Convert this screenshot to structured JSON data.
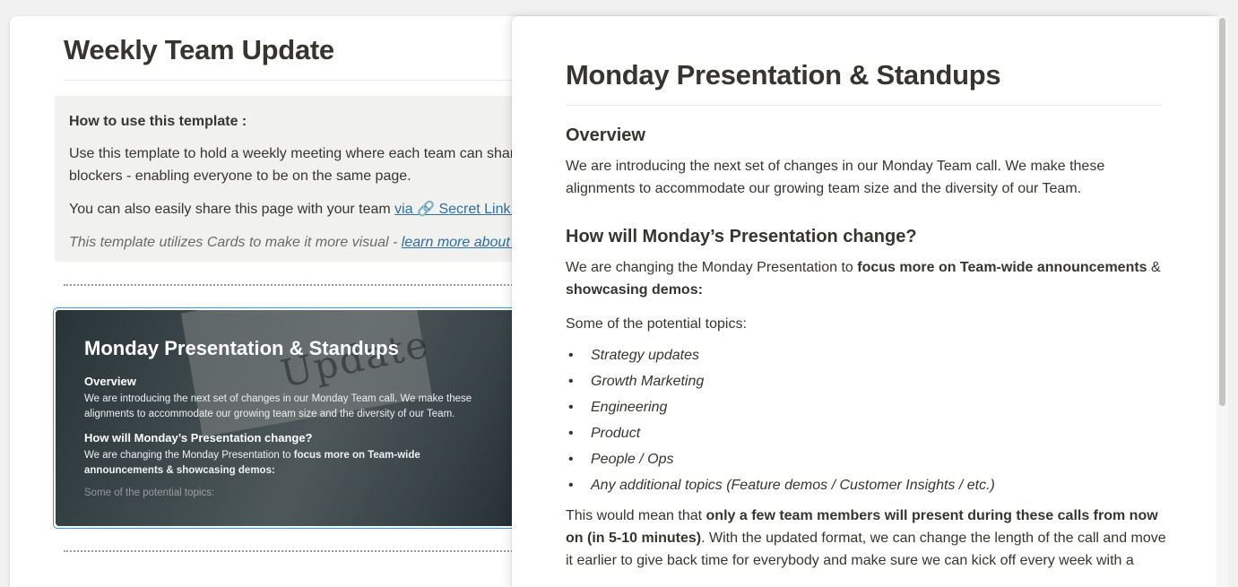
{
  "doc": {
    "title": "Weekly Team Update",
    "callout": {
      "heading": "How to use this template :",
      "line1": "Use this template to hold a weekly meeting where each team can share",
      "line2": "blockers - enabling everyone to be on the same page.",
      "share_text": "You can also easily share this page with your team ",
      "share_link": " via 🔗 Secret Link.",
      "cards_text": "This template utilizes Cards to make it more visual - ",
      "cards_link": "learn more about c"
    },
    "card": {
      "image_word": "Update",
      "title": "Monday Presentation & Standups",
      "overview_heading": "Overview",
      "overview_text": "We are introducing the next set of changes in our Monday Team call. We make these alignments to accommodate our growing team size and the diversity of our Team.",
      "change_heading": "How will Monday’s Presentation change?",
      "change_text_a": "We are changing the Monday Presentation to ",
      "change_text_b": "focus more on Team-wide announcements & showcasing demos:",
      "topics_text": "Some of the potential topics:"
    }
  },
  "peek": {
    "title": "Monday Presentation & Standups",
    "overview_heading": "Overview",
    "overview_text": "We are introducing the next set of changes in our Monday Team call. We make these alignments to accommodate our growing team size and the diversity of our Team.",
    "change_heading": "How will Monday’s Presentation change?",
    "change_text_a": "We are changing the Monday Presentation to ",
    "change_text_bold": "focus more on Team-wide announcements",
    "change_text_amp": " & ",
    "change_text_bold2": "showcasing demos:",
    "topics_intro": "Some of the potential topics:",
    "topics": [
      "Strategy updates",
      "Growth Marketing",
      "Engineering",
      "Product",
      "People / Ops",
      "Any additional topics (Feature demos / Customer Insights / etc.)"
    ],
    "mean_a": "This would mean that ",
    "mean_bold": "only a few team members will present during these calls from now on (in 5-10 minutes)",
    "mean_b": ". With the updated format, we can change the length of the call and move it earlier to give back time for everybody and make sure we can kick off every week with a"
  }
}
